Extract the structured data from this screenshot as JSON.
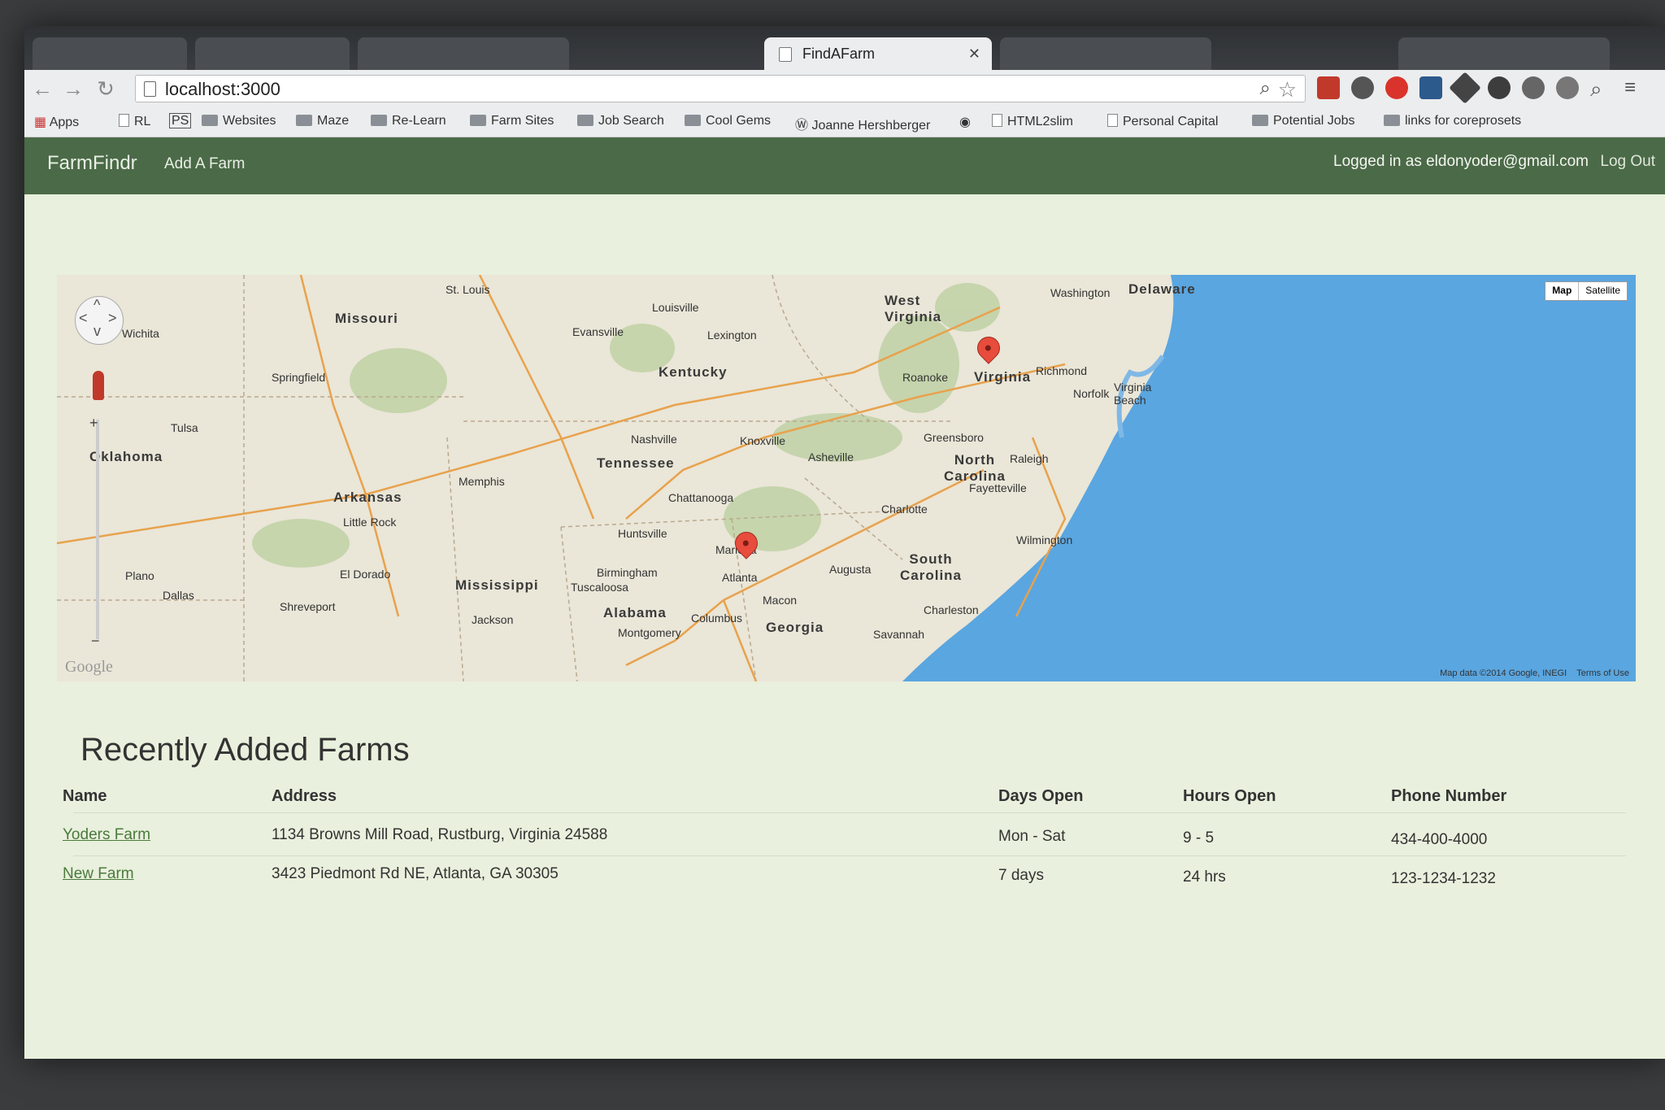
{
  "browser": {
    "active_tab": {
      "title": "FindAFarm"
    },
    "url": "localhost:3000",
    "bookmarks": [
      {
        "label": "Apps",
        "kind": "apps"
      },
      {
        "label": "RL",
        "kind": "file"
      },
      {
        "label": "PS",
        "kind": "badge"
      },
      {
        "label": "Websites",
        "kind": "folder"
      },
      {
        "label": "Maze",
        "kind": "folder"
      },
      {
        "label": "Re-Learn",
        "kind": "folder"
      },
      {
        "label": "Farm Sites",
        "kind": "folder"
      },
      {
        "label": "Job Search",
        "kind": "folder"
      },
      {
        "label": "Cool Gems",
        "kind": "folder"
      },
      {
        "label": "Joanne Hershberger",
        "kind": "wordpress"
      },
      {
        "label": "HTML2slim",
        "kind": "file"
      },
      {
        "label": "Personal Capital",
        "kind": "file"
      },
      {
        "label": "Potential Jobs",
        "kind": "folder"
      },
      {
        "label": "links for coreprosets",
        "kind": "folder"
      }
    ]
  },
  "app": {
    "brand": "FarmFindr",
    "nav": {
      "add_farm": "Add A Farm"
    },
    "user": {
      "logged_in_text": "Logged in as eldonyoder@gmail.com",
      "logout": "Log Out"
    }
  },
  "map": {
    "type_buttons": {
      "map": "Map",
      "satellite": "Satellite"
    },
    "attribution": "Map data ©2014 Google, INEGI",
    "terms": "Terms of Use",
    "logo": "Google",
    "labels": {
      "missouri": "Missouri",
      "kentucky": "Kentucky",
      "west_virginia": "West Virginia",
      "virginia": "Virginia",
      "delaware": "Delaware",
      "tennessee": "Tennessee",
      "north_carolina": "North Carolina",
      "south_carolina": "South Carolina",
      "arkansas": "Arkansas",
      "oklahoma": "Oklahoma",
      "mississippi": "Mississippi",
      "alabama": "Alabama",
      "georgia": "Georgia",
      "st_louis": "St. Louis",
      "louisville": "Louisville",
      "lexington": "Lexington",
      "nashville": "Nashville",
      "knoxville": "Knoxville",
      "memphis": "Memphis",
      "little_rock": "Little Rock",
      "tulsa": "Tulsa",
      "atlanta": "Atlanta",
      "birmingham": "Birmingham",
      "charlotte": "Charlotte",
      "raleigh": "Raleigh",
      "greensboro": "Greensboro",
      "richmond": "Richmond",
      "norfolk": "Norfolk",
      "washington": "Washington",
      "roanoke": "Roanoke",
      "dallas": "Dallas",
      "wichita": "Wichita",
      "springfield": "Springfield",
      "montgomery": "Montgomery",
      "savannah": "Savannah",
      "charleston": "Charleston",
      "augusta": "Augusta",
      "jackson": "Jackson",
      "chattanooga": "Chattanooga",
      "asheville": "Asheville",
      "wilmington": "Wilmington",
      "shreveport": "Shreveport",
      "marietta": "Marietta",
      "macon": "Macon",
      "columbus": "Columbus",
      "huntsville": "Huntsville",
      "fayetteville": "Fayetteville",
      "plano": "Plano",
      "virginia_beach": "Virginia Beach",
      "evansville": "Evansville",
      "tuscaloosa": "Tuscaloosa",
      "el_dorado": "El Dorado"
    }
  },
  "farms": {
    "title": "Recently Added Farms",
    "columns": [
      "Name",
      "Address",
      "Days Open",
      "Hours Open",
      "Phone Number"
    ],
    "rows": [
      {
        "name": "Yoders Farm",
        "address": "1134 Browns Mill Road, Rustburg, Virginia 24588",
        "days": "Mon - Sat",
        "hours": "9 - 5",
        "phone": "434-400-4000"
      },
      {
        "name": "New Farm",
        "address": "3423 Piedmont Rd NE, Atlanta, GA 30305",
        "days": "7 days",
        "hours": "24 hrs",
        "phone": "123-1234-1232"
      }
    ]
  },
  "colors": {
    "navbar": "#4b6a47",
    "link": "#4a7a3c",
    "ocean": "#5aa6e0",
    "land": "#eae6d8"
  }
}
